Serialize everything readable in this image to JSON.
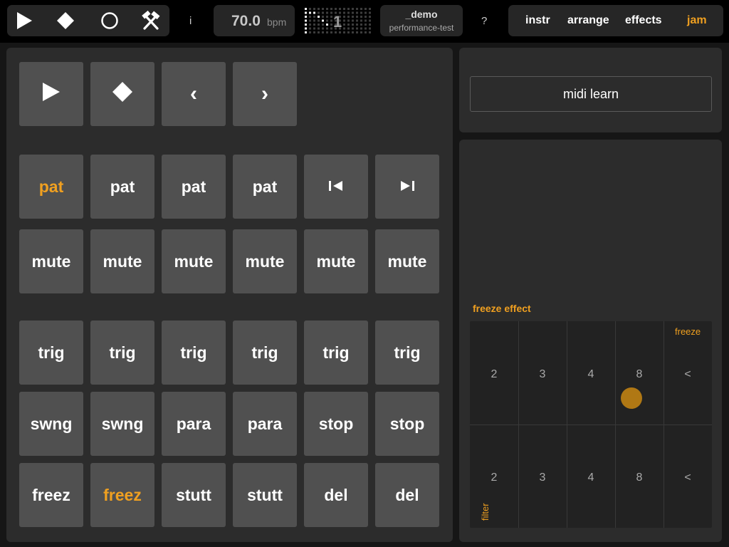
{
  "transport": {
    "icons": [
      "play-icon",
      "stop-icon",
      "record-icon",
      "tools-icon"
    ]
  },
  "header": {
    "info": "i",
    "bpm_value": "70.0",
    "bpm_unit": "bpm",
    "pattern_number": "1",
    "project_title": "_demo",
    "project_subtitle": "performance-test",
    "help": "?"
  },
  "tabs": [
    {
      "label": "instr",
      "active": false
    },
    {
      "label": "arrange",
      "active": false
    },
    {
      "label": "effects",
      "active": false
    },
    {
      "label": "jam",
      "active": true
    }
  ],
  "pads": {
    "transport": [
      {
        "icon": "play-icon"
      },
      {
        "icon": "stop-icon"
      },
      {
        "label": "‹"
      },
      {
        "label": "›"
      }
    ],
    "row_pat": [
      {
        "label": "pat",
        "active": true
      },
      {
        "label": "pat",
        "active": false
      },
      {
        "label": "pat",
        "active": false
      },
      {
        "label": "pat",
        "active": false
      },
      {
        "icon": "skip-start-icon"
      },
      {
        "icon": "skip-end-icon"
      }
    ],
    "row_mute": [
      "mute",
      "mute",
      "mute",
      "mute",
      "mute",
      "mute"
    ],
    "row_trig": [
      "trig",
      "trig",
      "trig",
      "trig",
      "trig",
      "trig"
    ],
    "row_swing": [
      "swng",
      "swng",
      "para",
      "para",
      "stop",
      "stop"
    ],
    "row_fx": [
      {
        "label": "freez",
        "active": false
      },
      {
        "label": "freez",
        "active": true
      },
      {
        "label": "stutt",
        "active": false
      },
      {
        "label": "stutt",
        "active": false
      },
      {
        "label": "del",
        "active": false
      },
      {
        "label": "del",
        "active": false
      }
    ]
  },
  "midi_learn": "midi learn",
  "xy_pad": {
    "title": "freeze effect",
    "x_axis_label": "freeze",
    "y_axis_label": "filter",
    "top_row": [
      "2",
      "3",
      "4",
      "8",
      "<"
    ],
    "bottom_row": [
      "2",
      "3",
      "4",
      "8",
      "<"
    ]
  },
  "colors": {
    "accent": "#f0a020",
    "pad": "#505050",
    "panel": "#2c2c2c",
    "dot": "#b07814"
  }
}
